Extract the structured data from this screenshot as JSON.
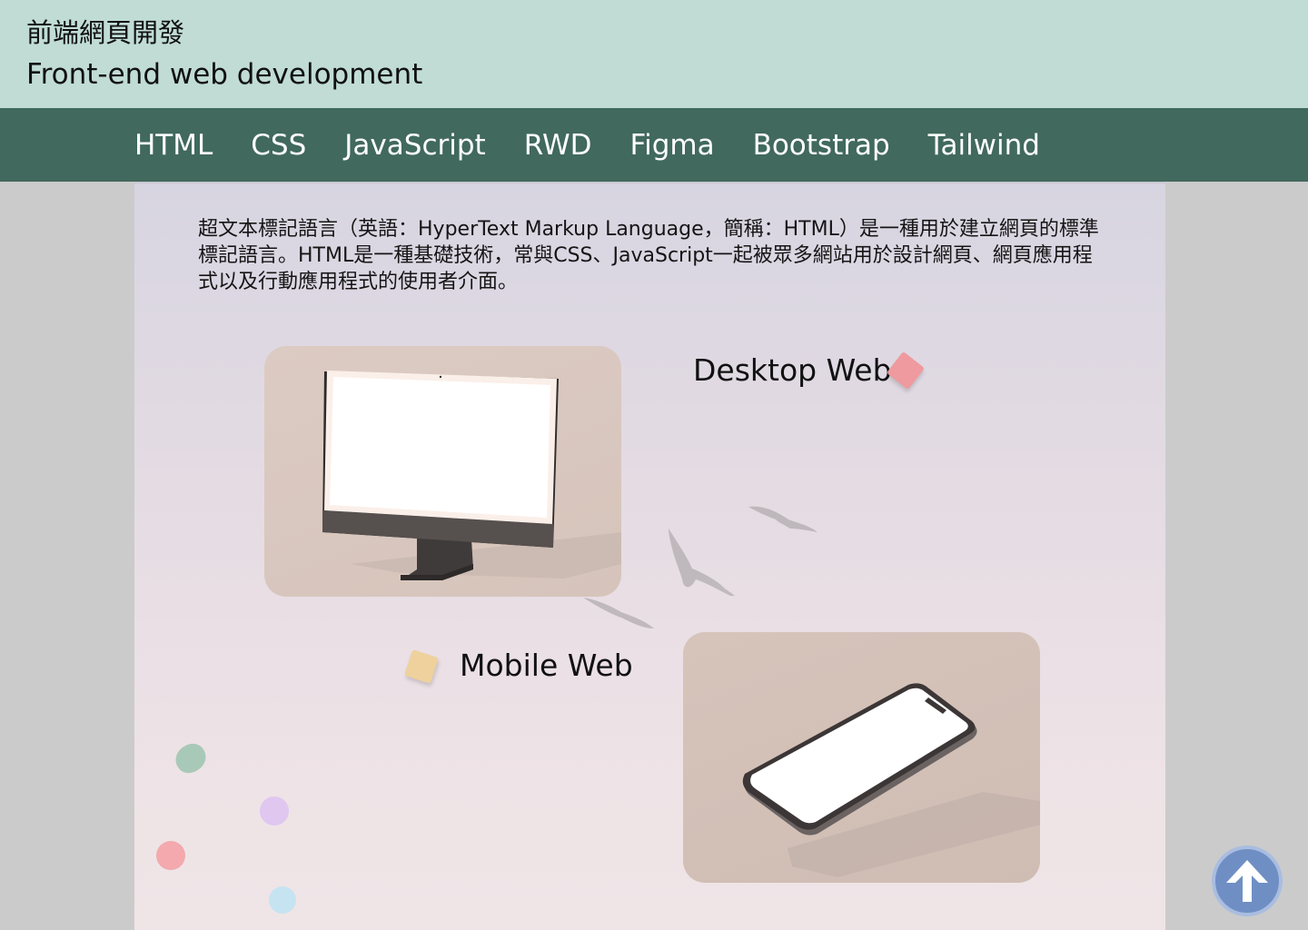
{
  "header": {
    "title_zh": "前端網頁開發",
    "title_en": "Front-end web development"
  },
  "nav": {
    "items": [
      "HTML",
      "CSS",
      "JavaScript",
      "RWD",
      "Figma",
      "Bootstrap",
      "Tailwind"
    ]
  },
  "main": {
    "intro": "超文本標記語言（英語：HyperText Markup Language，簡稱：HTML）是一種用於建立網頁的標準標記語言。HTML是一種基礎技術，常與CSS、JavaScript一起被眾多網站用於設計網頁、網頁應用程式以及行動應用程式的使用者介面。",
    "desktop_label": "Desktop Web",
    "mobile_label": "Mobile Web"
  },
  "icons": {
    "scroll_top": "arrow-up-icon",
    "desktop_image": "imac-illustration",
    "mobile_image": "iphone-illustration"
  },
  "colors": {
    "header_bg": "#c0dcd5",
    "nav_bg": "#41695d",
    "scroll_button": "#6f8fc4"
  }
}
